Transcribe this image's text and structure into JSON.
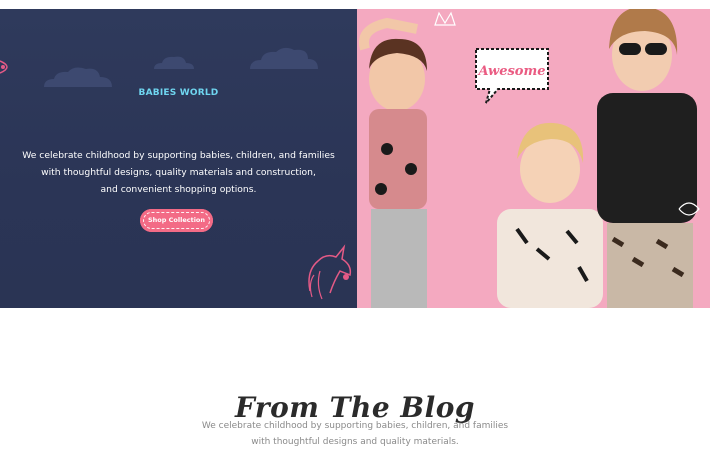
{
  "hero": {
    "brand": "BABIES WORLD",
    "description_lines": [
      "We celebrate childhood by supporting babies, children, and families",
      "with thoughtful designs, quality materials and construction,",
      "and convenient shopping options."
    ],
    "button_label": "Shop Collection",
    "speech_bubble": "Awesome",
    "colors": {
      "left_background": "#2f3a5c",
      "right_background": "#f4a9c0",
      "brand_text": "#6fd6f0",
      "button": "#f36b86"
    }
  },
  "blog": {
    "title": "From The Blog",
    "description_lines": [
      "We celebrate childhood by supporting babies, children, and families",
      "with thoughtful designs and quality materials."
    ]
  }
}
